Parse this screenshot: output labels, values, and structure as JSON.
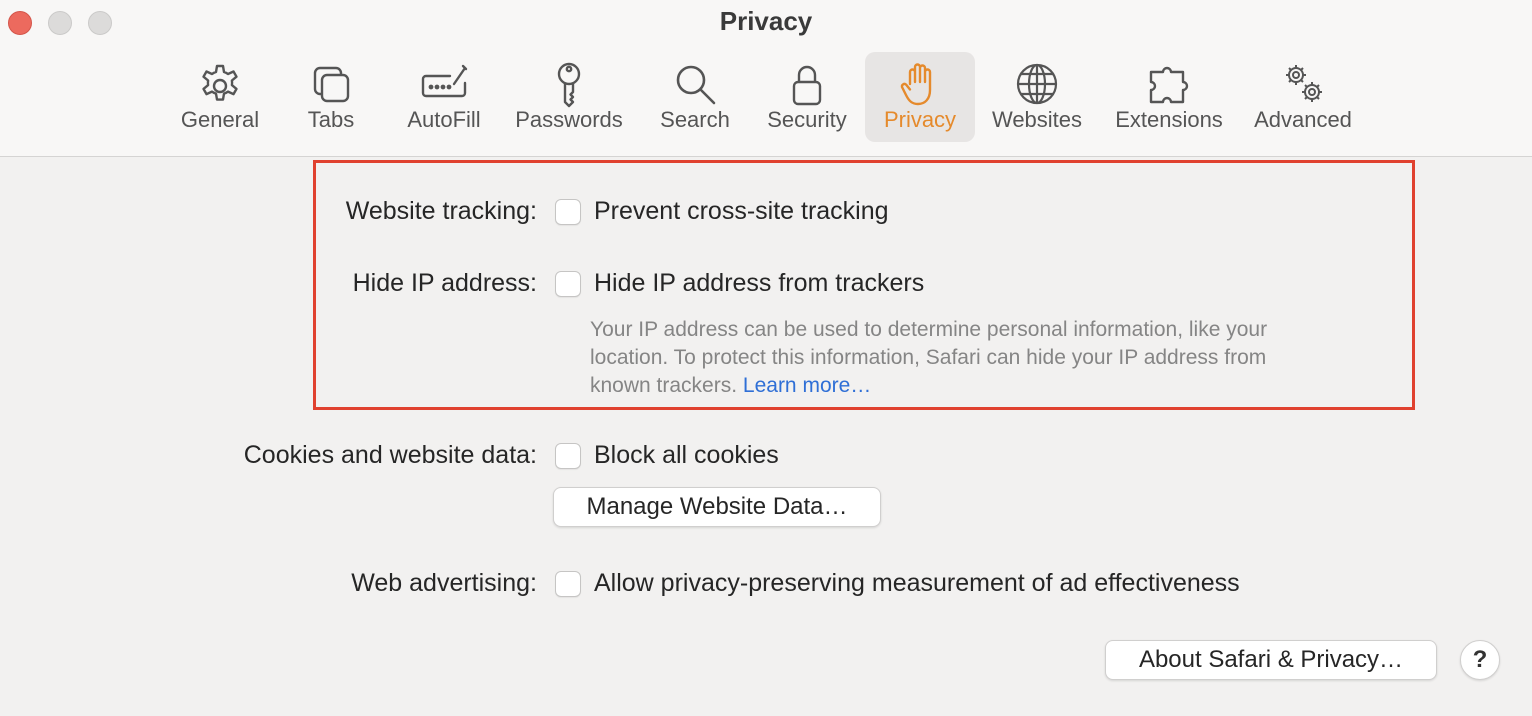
{
  "window": {
    "title": "Privacy"
  },
  "toolbar": {
    "tabs": [
      {
        "label": "General",
        "icon": "gear-icon",
        "active": false
      },
      {
        "label": "Tabs",
        "icon": "tabs-icon",
        "active": false
      },
      {
        "label": "AutoFill",
        "icon": "autofill-icon",
        "active": false
      },
      {
        "label": "Passwords",
        "icon": "key-icon",
        "active": false
      },
      {
        "label": "Search",
        "icon": "search-icon",
        "active": false
      },
      {
        "label": "Security",
        "icon": "lock-icon",
        "active": false
      },
      {
        "label": "Privacy",
        "icon": "hand-icon",
        "active": true
      },
      {
        "label": "Websites",
        "icon": "globe-icon",
        "active": false
      },
      {
        "label": "Extensions",
        "icon": "puzzle-icon",
        "active": false
      },
      {
        "label": "Advanced",
        "icon": "gears-icon",
        "active": false
      }
    ]
  },
  "settings": {
    "website_tracking": {
      "label": "Website tracking:",
      "option": "Prevent cross-site tracking",
      "checked": false
    },
    "hide_ip": {
      "label": "Hide IP address:",
      "option": "Hide IP address from trackers",
      "checked": false,
      "description": "Your IP address can be used to determine personal information, like your location. To protect this information, Safari can hide your IP address from known trackers.",
      "learn_more": "Learn more…"
    },
    "cookies": {
      "label": "Cookies and website data:",
      "option": "Block all cookies",
      "checked": false,
      "manage_button": "Manage Website Data…"
    },
    "web_advertising": {
      "label": "Web advertising:",
      "option": "Allow privacy-preserving measurement of ad effectiveness",
      "checked": false
    }
  },
  "footer": {
    "about_button": "About Safari & Privacy…",
    "help_button": "?"
  },
  "colors": {
    "accent_active_tab": "#e58a2c",
    "highlight_box": "#e0412f",
    "link": "#2f6fd6"
  }
}
